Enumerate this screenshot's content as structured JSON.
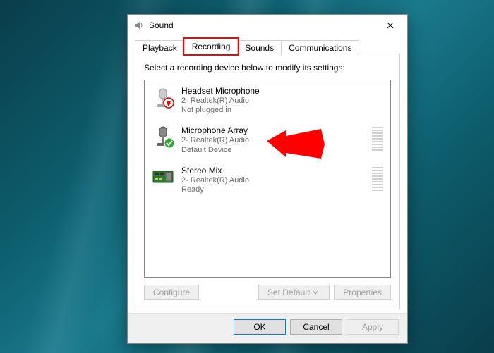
{
  "window": {
    "title": "Sound"
  },
  "tabs": [
    {
      "label": "Playback",
      "active": false
    },
    {
      "label": "Recording",
      "active": true,
      "highlighted": true
    },
    {
      "label": "Sounds",
      "active": false
    },
    {
      "label": "Communications",
      "active": false
    }
  ],
  "instruction": "Select a recording device below to modify its settings:",
  "devices": [
    {
      "name": "Headset Microphone",
      "driver": "2- Realtek(R) Audio",
      "status": "Not plugged in",
      "icon": "headset",
      "badge": "unplugged",
      "meter": false
    },
    {
      "name": "Microphone Array",
      "driver": "2- Realtek(R) Audio",
      "status": "Default Device",
      "icon": "mic",
      "badge": "default",
      "meter": true
    },
    {
      "name": "Stereo Mix",
      "driver": "2- Realtek(R) Audio",
      "status": "Ready",
      "icon": "card",
      "badge": null,
      "meter": true
    }
  ],
  "buttons": {
    "configure": "Configure",
    "set_default": "Set Default",
    "properties": "Properties",
    "ok": "OK",
    "cancel": "Cancel",
    "apply": "Apply"
  }
}
